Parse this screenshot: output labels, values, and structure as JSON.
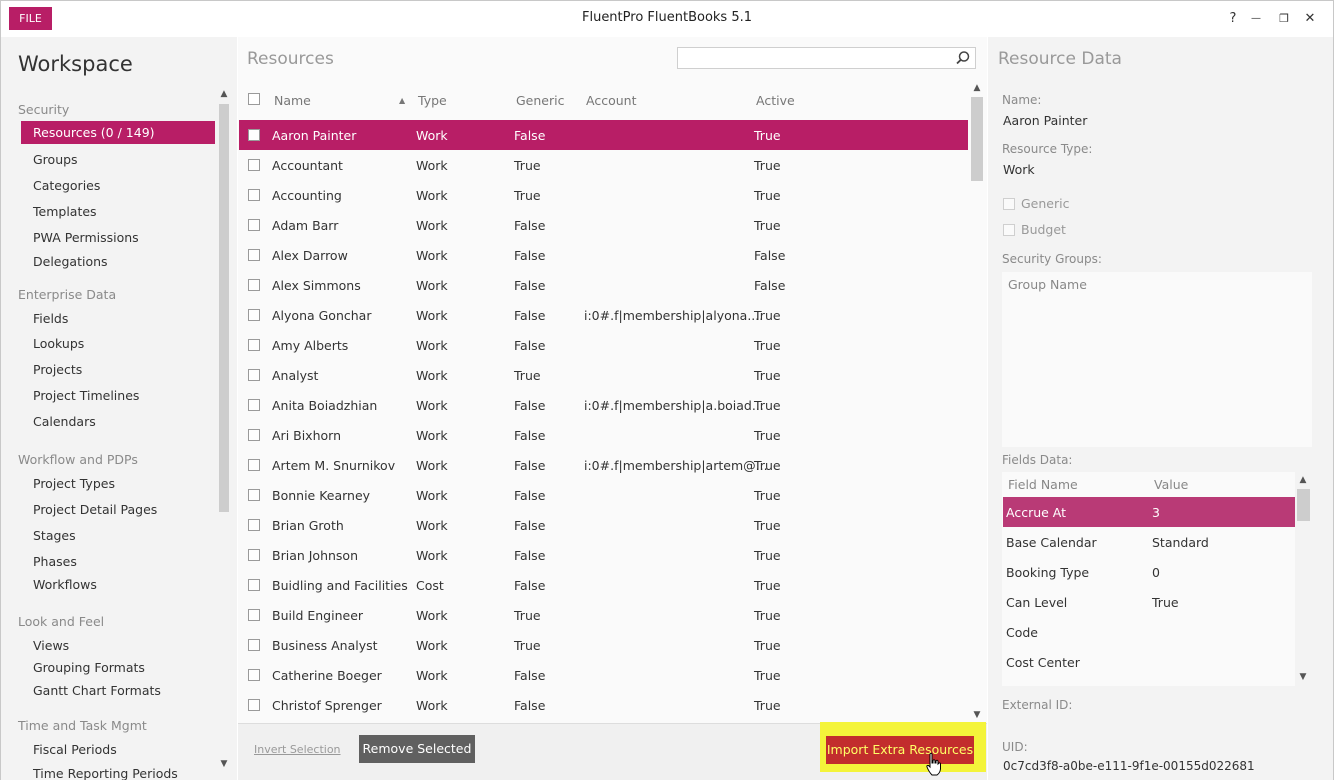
{
  "window": {
    "file_label": "FILE",
    "title": "FluentPro FluentBooks 5.1",
    "help": "?",
    "minimize": "—",
    "restore": "❐",
    "close": "✕"
  },
  "workspace": {
    "title": "Workspace",
    "sections": {
      "security": "Security",
      "enterprise": "Enterprise Data",
      "workflow": "Workflow and PDPs",
      "look": "Look and Feel",
      "time": "Time and Task Mgmt"
    },
    "items": {
      "resources": "Resources (0 / 149)",
      "groups": "Groups",
      "categories": "Categories",
      "templates": "Templates",
      "pwa": "PWA Permissions",
      "delegations": "Delegations",
      "fields": "Fields",
      "lookups": "Lookups",
      "projects": "Projects",
      "timelines": "Project Timelines",
      "calendars": "Calendars",
      "ptypes": "Project Types",
      "pdp": "Project Detail Pages",
      "stages": "Stages",
      "phases": "Phases",
      "workflows": "Workflows",
      "views": "Views",
      "grouping": "Grouping Formats",
      "gantt": "Gantt Chart Formats",
      "fiscal": "Fiscal Periods",
      "trp": "Time Reporting Periods"
    }
  },
  "resources": {
    "title": "Resources",
    "search_value": "",
    "columns": {
      "name": "Name",
      "type": "Type",
      "generic": "Generic",
      "account": "Account",
      "active": "Active"
    },
    "rows": [
      {
        "name": "Aaron Painter",
        "type": "Work",
        "generic": "False",
        "account": "",
        "active": "True"
      },
      {
        "name": "Accountant",
        "type": "Work",
        "generic": "True",
        "account": "",
        "active": "True"
      },
      {
        "name": "Accounting",
        "type": "Work",
        "generic": "True",
        "account": "",
        "active": "True"
      },
      {
        "name": "Adam Barr",
        "type": "Work",
        "generic": "False",
        "account": "",
        "active": "True"
      },
      {
        "name": "Alex Darrow",
        "type": "Work",
        "generic": "False",
        "account": "",
        "active": "False"
      },
      {
        "name": "Alex Simmons",
        "type": "Work",
        "generic": "False",
        "account": "",
        "active": "False"
      },
      {
        "name": "Alyona Gonchar",
        "type": "Work",
        "generic": "False",
        "account": "i:0#.f|membership|alyona....",
        "active": "True"
      },
      {
        "name": "Amy Alberts",
        "type": "Work",
        "generic": "False",
        "account": "",
        "active": "True"
      },
      {
        "name": "Analyst",
        "type": "Work",
        "generic": "True",
        "account": "",
        "active": "True"
      },
      {
        "name": "Anita Boiadzhian",
        "type": "Work",
        "generic": "False",
        "account": "i:0#.f|membership|a.boiad...",
        "active": "True"
      },
      {
        "name": "Ari Bixhorn",
        "type": "Work",
        "generic": "False",
        "account": "",
        "active": "True"
      },
      {
        "name": "Artem M. Snurnikov",
        "type": "Work",
        "generic": "False",
        "account": "i:0#.f|membership|artem@...",
        "active": "True"
      },
      {
        "name": "Bonnie Kearney",
        "type": "Work",
        "generic": "False",
        "account": "",
        "active": "True"
      },
      {
        "name": "Brian Groth",
        "type": "Work",
        "generic": "False",
        "account": "",
        "active": "True"
      },
      {
        "name": "Brian Johnson",
        "type": "Work",
        "generic": "False",
        "account": "",
        "active": "True"
      },
      {
        "name": "Buidling and Facilities",
        "type": "Cost",
        "generic": "False",
        "account": "",
        "active": "True"
      },
      {
        "name": "Build Engineer",
        "type": "Work",
        "generic": "True",
        "account": "",
        "active": "True"
      },
      {
        "name": "Business Analyst",
        "type": "Work",
        "generic": "True",
        "account": "",
        "active": "True"
      },
      {
        "name": "Catherine Boeger",
        "type": "Work",
        "generic": "False",
        "account": "",
        "active": "True"
      },
      {
        "name": "Christof Sprenger",
        "type": "Work",
        "generic": "False",
        "account": "",
        "active": "True"
      }
    ],
    "invert_label": "Invert Selection",
    "remove_label": "Remove Selected",
    "import_label": "Import Extra Resources"
  },
  "resource_data": {
    "title": "Resource Data",
    "name_label": "Name:",
    "name_value": "Aaron Painter",
    "type_label": "Resource Type:",
    "type_value": "Work",
    "generic_label": "Generic",
    "budget_label": "Budget",
    "groups_label": "Security Groups:",
    "group_name_header": "Group Name",
    "fields_label": "Fields Data:",
    "field_name_header": "Field Name",
    "value_header": "Value",
    "fields": [
      {
        "name": "Accrue At",
        "value": "3"
      },
      {
        "name": "Base Calendar",
        "value": "Standard"
      },
      {
        "name": "Booking Type",
        "value": "0"
      },
      {
        "name": "Can Level",
        "value": "True"
      },
      {
        "name": "Code",
        "value": ""
      },
      {
        "name": "Cost Center",
        "value": ""
      }
    ],
    "external_label": "External ID:",
    "uid_label": "UID:",
    "uid_value": "0c7cd3f8-a0be-e111-9f1e-00155d022681"
  },
  "colors": {
    "accent": "#b81e66",
    "import_button": "#c22d2d",
    "highlight": "#f4f43a"
  }
}
